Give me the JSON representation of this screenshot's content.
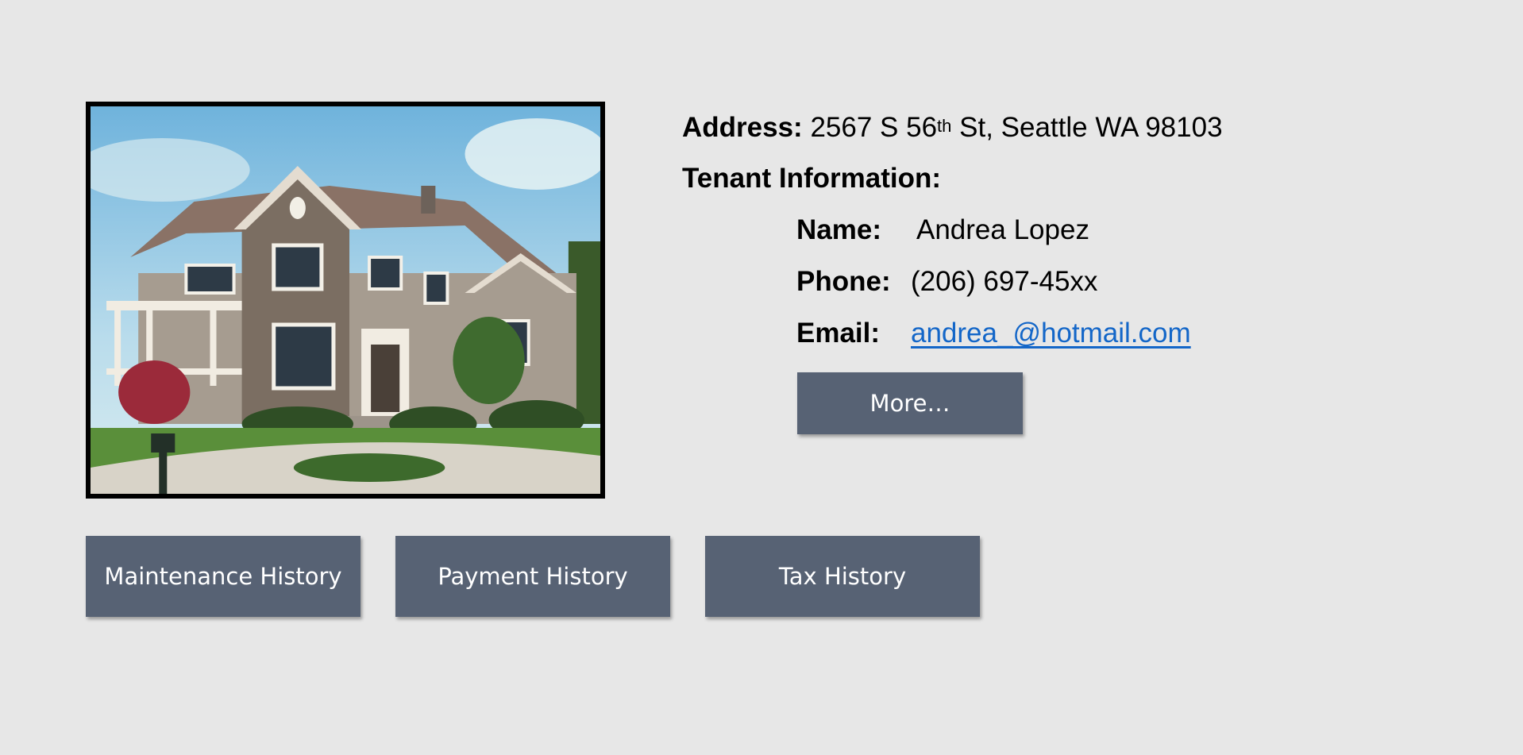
{
  "property": {
    "address_label": "Address:",
    "address_pre": "2567 S 56",
    "address_sup": "th",
    "address_post": " St, Seattle WA 98103"
  },
  "tenant": {
    "section_label": "Tenant Information:",
    "name_label": "Name:",
    "name_value": "Andrea Lopez",
    "phone_label": "Phone:",
    "phone_value": "(206) 697-45xx",
    "email_label": "Email:",
    "email_value": "andrea_@hotmail.com",
    "more_button": "More…"
  },
  "actions": {
    "maintenance_history": "Maintenance History",
    "payment_history": "Payment History",
    "tax_history": "Tax History"
  },
  "colors": {
    "background": "#e7e7e7",
    "button": "#576274",
    "link": "#1366c8"
  }
}
